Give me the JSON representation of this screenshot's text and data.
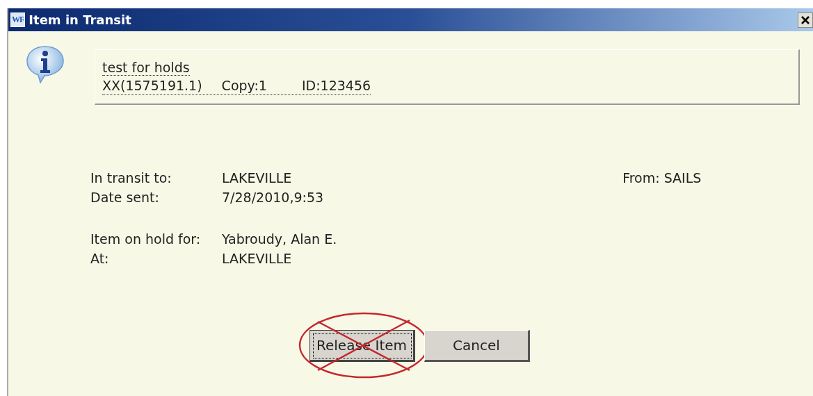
{
  "window": {
    "icon_text": "WF",
    "title": "Item in Transit"
  },
  "item": {
    "title": "test for holds",
    "call_number": "XX(1575191.1)",
    "copy": "Copy:1",
    "id": "ID:123456"
  },
  "transit": [
    {
      "label": "In transit to:",
      "value": "LAKEVILLE"
    },
    {
      "label": "Date sent:",
      "value": "7/28/2010,9:53"
    }
  ],
  "from": "From: SAILS",
  "hold": [
    {
      "label": "Item on hold for:",
      "value": "Yabroudy, Alan E."
    },
    {
      "label": "At:",
      "value": "LAKEVILLE"
    }
  ],
  "buttons": [
    {
      "label": "Release Item",
      "focused": true,
      "crossed_out": true
    },
    {
      "label": "Cancel",
      "focused": false,
      "crossed_out": false
    }
  ]
}
